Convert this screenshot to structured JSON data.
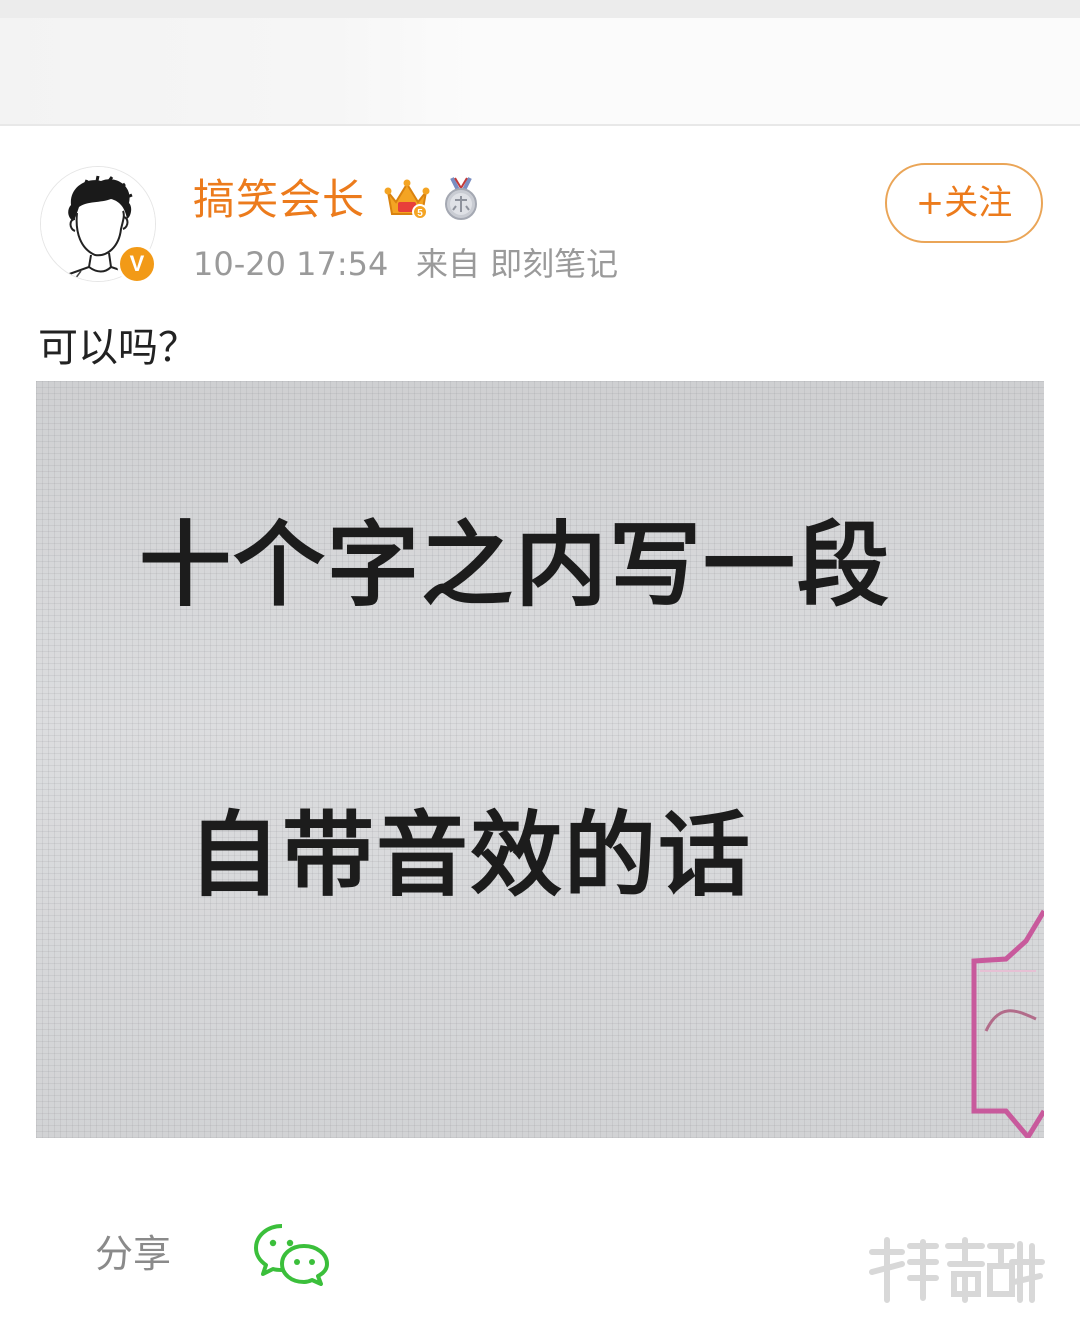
{
  "post": {
    "username": "搞笑会长",
    "timestamp": "10-20 17:54",
    "source": "来自 即刻笔记",
    "follow_label": "+关注",
    "verified_badge": "V",
    "text": "可以吗？"
  },
  "image": {
    "line1": "十个字之内写一段",
    "line2": "自带音效的话"
  },
  "footer": {
    "share_label": "分享"
  },
  "icons": {
    "crown": "crown-icon",
    "medal": "medal-icon",
    "wechat": "wechat-icon",
    "watermark": "watermark-logo"
  },
  "colors": {
    "username": "#ec7b1c",
    "follow_border": "#eaa557",
    "verified": "#f29a17",
    "wechat": "#3bbf3b",
    "meta": "#9a9a9a"
  }
}
